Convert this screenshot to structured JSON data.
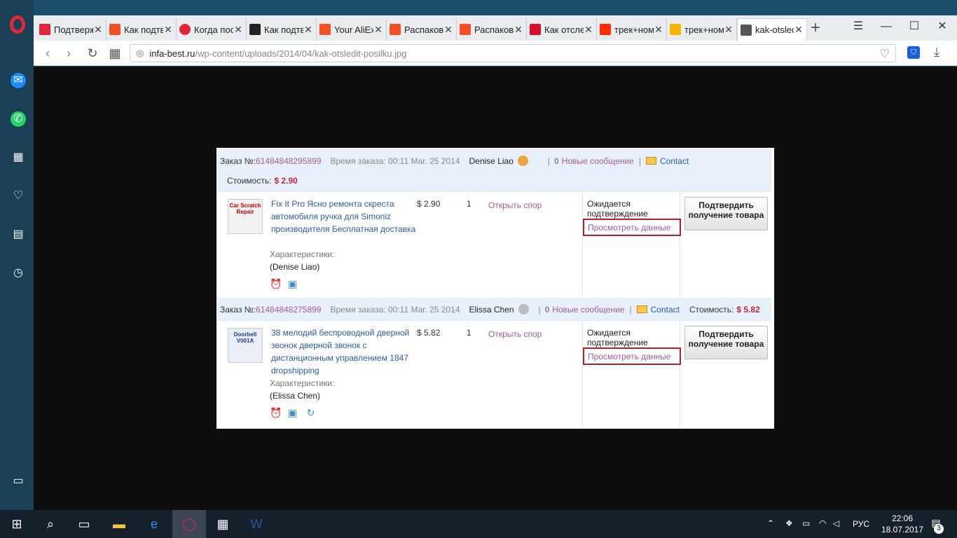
{
  "browser": {
    "tabs": [
      {
        "title": "Подтверждение",
        "favicon_color": "#e3263a"
      },
      {
        "title": "Как подтвердить",
        "favicon_color": "#f25022"
      },
      {
        "title": "Когда после",
        "favicon_color": "#e3263a"
      },
      {
        "title": "Как подтвердить",
        "favicon_color": "#222222"
      },
      {
        "title": "Your AliExpress",
        "favicon_color": "#f25022"
      },
      {
        "title": "Распаковка",
        "favicon_color": "#f25022"
      },
      {
        "title": "Распаковка",
        "favicon_color": "#f25022"
      },
      {
        "title": "Как отследить",
        "favicon_color": "#d6102b"
      },
      {
        "title": "трек+номер",
        "favicon_color": "#ff2d00"
      },
      {
        "title": "трек+номер",
        "favicon_color": "#f7b500"
      },
      {
        "title": "kak-otsledit",
        "favicon_color": "#555555",
        "active": true
      }
    ],
    "new_tab": "+",
    "url_host": "infa-best.ru",
    "url_path": "/wp-content/uploads/2014/04/kak-otsledit-posilku.jpg"
  },
  "orders": [
    {
      "order_label": "Заказ №:",
      "order_number": "61484848295899",
      "time_label": "Время заказа: 00:11 Mar. 25 2014",
      "seller": "Denise Liao",
      "messages_count": "0",
      "messages_label": "Новые сообщение",
      "contact": "Contact",
      "cost_label": "Стоимость:",
      "cost": "$ 2.90",
      "thumb_text": "Car Scratch Repair",
      "item_title": "Fix It Pro Ясно ремонта скреста автомобиля ручка для Simoniz производителя Бесплатная доставка",
      "price": "$ 2.90",
      "qty": "1",
      "dispute": "Открыть спор",
      "chars_label": "Характеристики:",
      "buyer": "(Denise Liao)",
      "status": "Ожидается подтверждение",
      "details": "Просмотреть данные",
      "confirm": "Подтвердить получение товара"
    },
    {
      "order_label": "Заказ №:",
      "order_number": "61484848275899",
      "time_label": "Время заказа: 00:11 Mar. 25 2014",
      "seller": "Elissa Chen",
      "messages_count": "0",
      "messages_label": "Новые сообщение",
      "contact": "Contact",
      "cost_label": "Стоимость:",
      "cost": "$ 5.82",
      "thumb_text": "Doorbell V001A",
      "item_title": "38 мелодий беспроводной дверной звонок дверной звонок с дистанционным управлением 1847 dropshipping",
      "price": "$ 5.82",
      "qty": "1",
      "dispute": "Открыть спор",
      "chars_label": "Характеристики:",
      "buyer": "(Elissa Chen)",
      "status": "Ожидается подтверждение",
      "details": "Просмотреть данные",
      "confirm": "Подтвердить получение товара"
    }
  ],
  "taskbar": {
    "lang": "РУС",
    "time": "22:06",
    "date": "18.07.2017",
    "notifications": "3"
  },
  "colors": {
    "accent_link": "#2a5ba8",
    "price_red": "#c0282d",
    "highlight_box": "#b0202a",
    "order_head_bg": "#e8f1fb"
  }
}
